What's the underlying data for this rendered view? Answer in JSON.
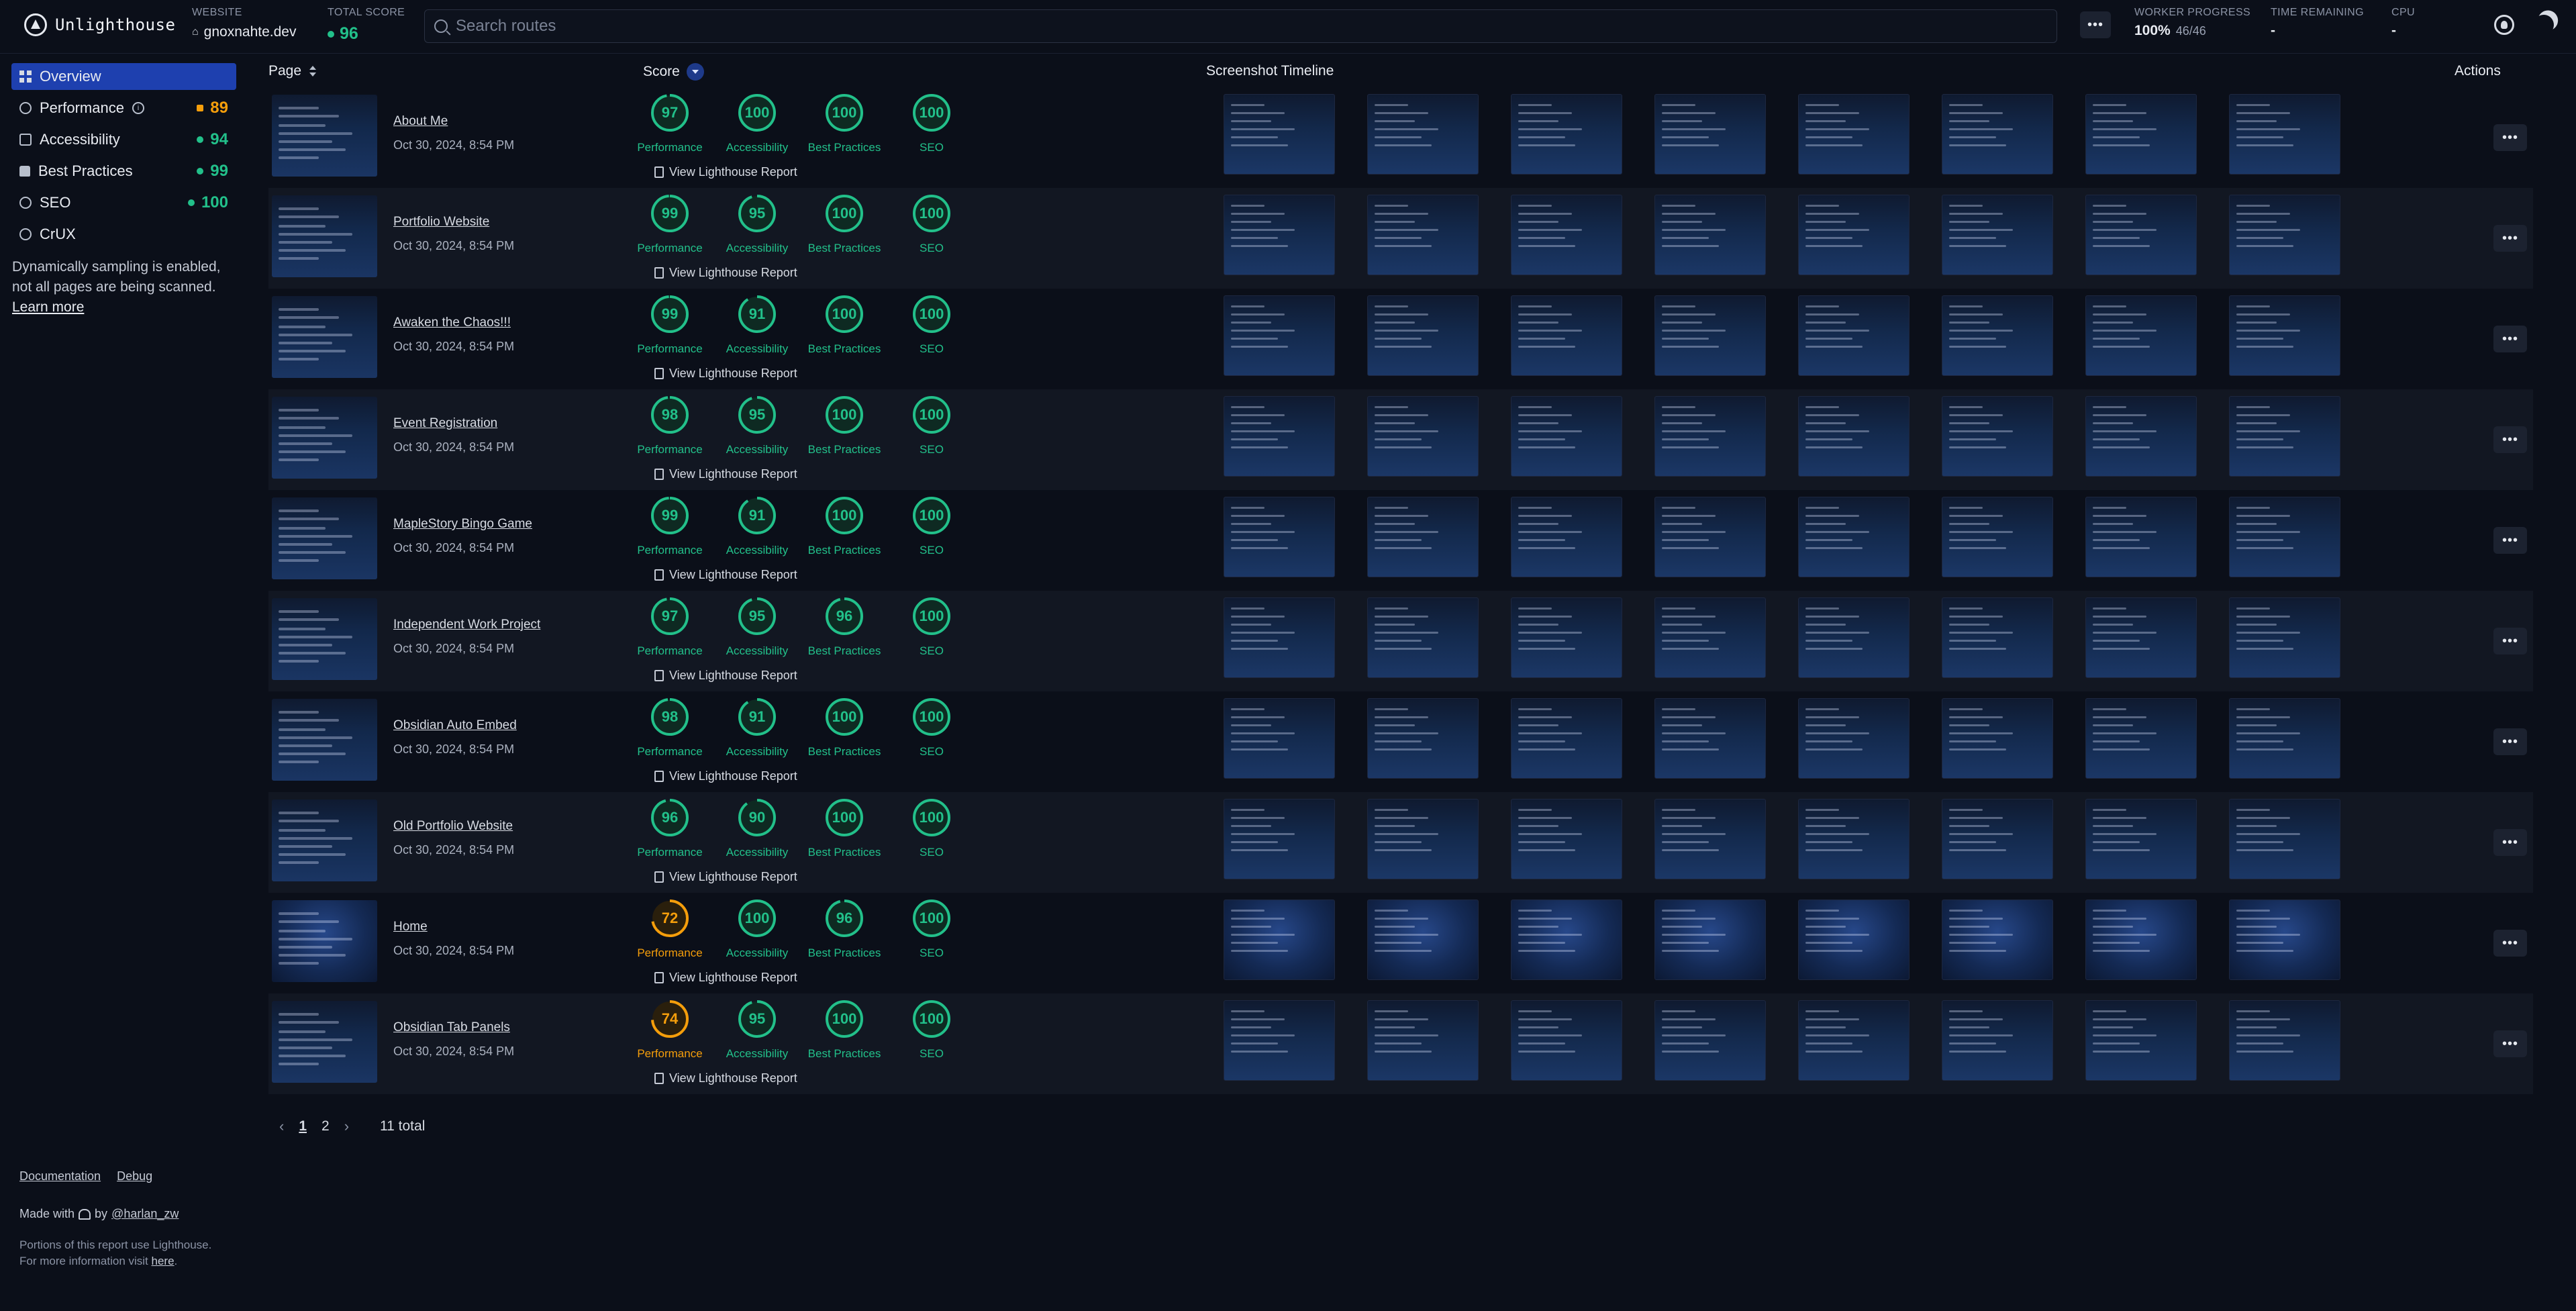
{
  "header": {
    "app_name": "Unlighthouse",
    "website_label": "WEBSITE",
    "website_value": "gnoxnahte.dev",
    "total_score_label": "TOTAL SCORE",
    "total_score_value": "96",
    "search_placeholder": "Search routes",
    "more_label": "•••",
    "worker_progress_label": "WORKER PROGRESS",
    "worker_progress_value": "100%",
    "worker_progress_count": "46/46",
    "time_remaining_label": "TIME REMAINING",
    "time_remaining_value": "-",
    "cpu_label": "CPU",
    "cpu_value": "-",
    "icons": [
      "lighthouse-logo-icon",
      "home-icon",
      "search-icon",
      "github-icon",
      "moon-icon"
    ]
  },
  "sidebar": {
    "items": [
      {
        "label": "Overview",
        "icon": "grid-icon",
        "active": true,
        "score": ""
      },
      {
        "label": "Performance",
        "icon": "gauge-icon",
        "active": false,
        "score": "89",
        "status": "orange"
      },
      {
        "label": "Accessibility",
        "icon": "accessibility-icon",
        "active": false,
        "score": "94",
        "status": "green"
      },
      {
        "label": "Best Practices",
        "icon": "thumbs-up-icon",
        "active": false,
        "score": "99",
        "status": "green"
      },
      {
        "label": "SEO",
        "icon": "globe-icon",
        "active": false,
        "score": "100",
        "status": "green"
      },
      {
        "label": "CrUX",
        "icon": "crux-icon",
        "active": false,
        "score": ""
      }
    ],
    "sampling_text": "Dynamically sampling is enabled, not all pages are being scanned.",
    "learn_more": "Learn more",
    "documentation": "Documentation",
    "debug": "Debug",
    "made_with": "Made with",
    "by": "by",
    "author": "@harlan_zw",
    "portions_text": "Portions of this report use Lighthouse. For more information visit",
    "here": "here",
    "period": "."
  },
  "table": {
    "headers": {
      "page": "Page",
      "score": "Score",
      "timeline": "Screenshot Timeline",
      "actions": "Actions"
    },
    "score_labels": [
      "Performance",
      "Accessibility",
      "Best Practices",
      "SEO"
    ],
    "report_link": "View Lighthouse Report",
    "rows": [
      {
        "title": "About Me",
        "date": "Oct 30, 2024, 8:54 PM",
        "scores": [
          "97",
          "100",
          "100",
          "100"
        ],
        "thumb": "page"
      },
      {
        "title": "Portfolio Website",
        "date": "Oct 30, 2024, 8:54 PM",
        "scores": [
          "99",
          "95",
          "100",
          "100"
        ],
        "thumb": "page"
      },
      {
        "title": "Awaken the Chaos!!!",
        "date": "Oct 30, 2024, 8:54 PM",
        "scores": [
          "99",
          "91",
          "100",
          "100"
        ],
        "thumb": "page"
      },
      {
        "title": "Event Registration",
        "date": "Oct 30, 2024, 8:54 PM",
        "scores": [
          "98",
          "95",
          "100",
          "100"
        ],
        "thumb": "page"
      },
      {
        "title": "MapleStory Bingo Game",
        "date": "Oct 30, 2024, 8:54 PM",
        "scores": [
          "99",
          "91",
          "100",
          "100"
        ],
        "thumb": "page"
      },
      {
        "title": "Independent Work Project",
        "date": "Oct 30, 2024, 8:54 PM",
        "scores": [
          "97",
          "95",
          "96",
          "100"
        ],
        "thumb": "page"
      },
      {
        "title": "Obsidian Auto Embed",
        "date": "Oct 30, 2024, 8:54 PM",
        "scores": [
          "98",
          "91",
          "100",
          "100"
        ],
        "thumb": "page"
      },
      {
        "title": "Old Portfolio Website",
        "date": "Oct 30, 2024, 8:54 PM",
        "scores": [
          "96",
          "90",
          "100",
          "100"
        ],
        "thumb": "page"
      },
      {
        "title": "Home",
        "date": "Oct 30, 2024, 8:54 PM",
        "scores": [
          "72",
          "100",
          "96",
          "100"
        ],
        "thumb": "home"
      },
      {
        "title": "Obsidian Tab Panels",
        "date": "Oct 30, 2024, 8:54 PM",
        "scores": [
          "74",
          "95",
          "100",
          "100"
        ],
        "thumb": "page"
      }
    ],
    "action_label": "•••"
  },
  "pagination": {
    "prev": "‹",
    "pages": [
      "1",
      "2"
    ],
    "current": "1",
    "next": "›",
    "total": "11 total"
  },
  "colors": {
    "good": "#22c08a",
    "average": "#f59e0b",
    "accent": "#1e40af"
  }
}
